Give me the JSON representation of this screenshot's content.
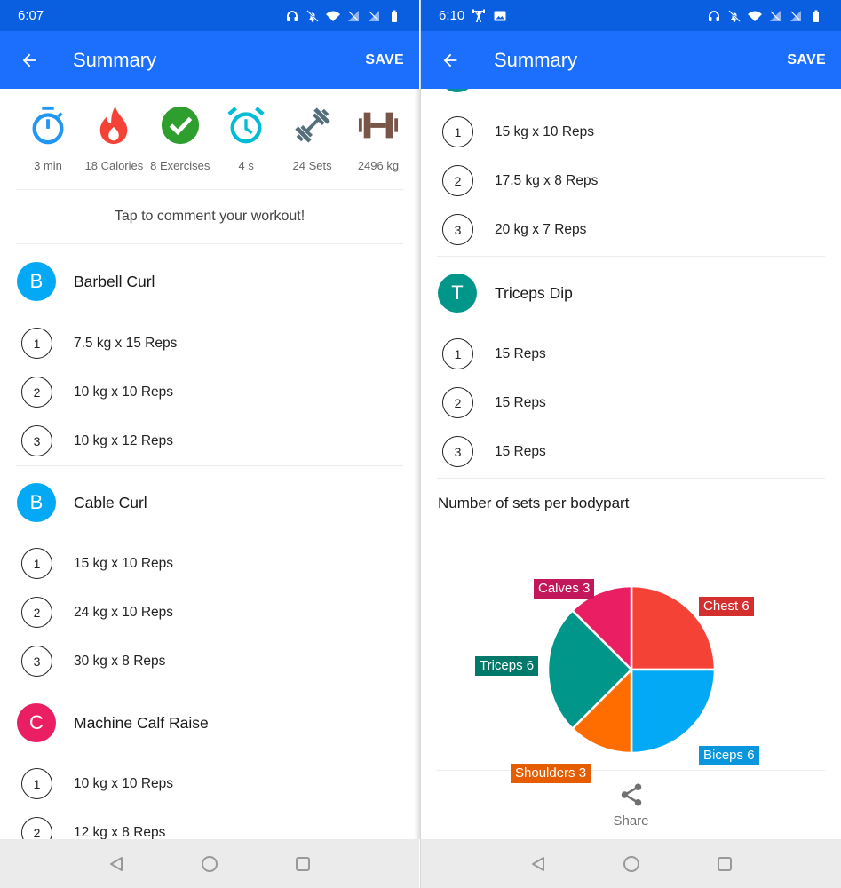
{
  "screens": [
    {
      "status_bar": {
        "time": "6:07",
        "left_icons": [],
        "right_icons": [
          "headset-icon",
          "bell-off-icon",
          "wifi-icon",
          "signal-off-icon",
          "signal-off-icon",
          "battery-icon"
        ]
      },
      "app_bar": {
        "back_icon": "arrow-back-icon",
        "title": "Summary",
        "save_label": "SAVE"
      },
      "stats": [
        {
          "icon": "stopwatch-icon",
          "label": "3 min",
          "color": "#2196f3"
        },
        {
          "icon": "flame-icon",
          "label": "18 Calories",
          "color": "#f44336"
        },
        {
          "icon": "check-circle-icon",
          "label": "8 Exercises",
          "color": "#2e9e2e"
        },
        {
          "icon": "alarm-clock-icon",
          "label": "4 s",
          "color": "#00bcd4"
        },
        {
          "icon": "dumbbell-icon",
          "label": "24 Sets",
          "color": "#546e7a"
        },
        {
          "icon": "weight-plates-icon",
          "label": "2496 kg",
          "color": "#795548"
        }
      ],
      "comment_prompt": "Tap to comment your workout!",
      "exercises": [
        {
          "initial": "B",
          "name": "Barbell Curl",
          "color": "#03a9f4",
          "sets": [
            {
              "num": "1",
              "text": "7.5 kg x 15 Reps"
            },
            {
              "num": "2",
              "text": "10 kg x 10 Reps"
            },
            {
              "num": "3",
              "text": "10 kg x 12 Reps"
            }
          ]
        },
        {
          "initial": "B",
          "name": "Cable Curl",
          "color": "#03a9f4",
          "sets": [
            {
              "num": "1",
              "text": "15 kg x 10 Reps"
            },
            {
              "num": "2",
              "text": "24 kg x 10 Reps"
            },
            {
              "num": "3",
              "text": "30 kg x 8 Reps"
            }
          ]
        },
        {
          "initial": "C",
          "name": "Machine Calf Raise",
          "color": "#e91e63",
          "sets": [
            {
              "num": "1",
              "text": "10 kg x 10 Reps"
            },
            {
              "num": "2",
              "text": "12 kg x 8 Reps"
            }
          ]
        }
      ],
      "nav_bar": [
        "back-nav-icon",
        "home-nav-icon",
        "recents-nav-icon"
      ]
    },
    {
      "status_bar": {
        "time": "6:10",
        "left_icons": [
          "weightlifter-icon",
          "image-icon"
        ],
        "right_icons": [
          "headset-icon",
          "bell-off-icon",
          "wifi-icon",
          "signal-off-icon",
          "signal-off-icon",
          "battery-icon"
        ]
      },
      "app_bar": {
        "back_icon": "arrow-back-icon",
        "title": "Summary",
        "save_label": "SAVE"
      },
      "partial_exercise": {
        "color": "#00968a",
        "sets": [
          {
            "num": "1",
            "text": "15 kg x 10 Reps"
          },
          {
            "num": "2",
            "text": "17.5 kg x 8 Reps"
          },
          {
            "num": "3",
            "text": "20 kg x 7 Reps"
          }
        ]
      },
      "exercises": [
        {
          "initial": "T",
          "name": "Triceps Dip",
          "color": "#00968a",
          "sets": [
            {
              "num": "1",
              "text": "15 Reps"
            },
            {
              "num": "2",
              "text": "15 Reps"
            },
            {
              "num": "3",
              "text": "15 Reps"
            }
          ]
        }
      ],
      "chart_title": "Number of sets per bodypart",
      "share_label": "Share",
      "nav_bar": [
        "back-nav-icon",
        "home-nav-icon",
        "recents-nav-icon"
      ]
    }
  ],
  "chart_data": {
    "type": "pie",
    "title": "Number of sets per bodypart",
    "categories": [
      "Chest",
      "Biceps",
      "Shoulders",
      "Triceps",
      "Calves"
    ],
    "values": [
      6,
      6,
      3,
      6,
      3
    ],
    "labels": [
      "Chest 6",
      "Biceps 6",
      "Shoulders 3",
      "Triceps 6",
      "Calves 3"
    ],
    "colors": [
      "#f44336",
      "#03a9f4",
      "#ff6d00",
      "#00968a",
      "#e91e63"
    ],
    "label_colors": [
      "#d32f2f",
      "#0a96dc",
      "#e65c00",
      "#00796b",
      "#c2185b"
    ],
    "start": "top",
    "direction": "clockwise",
    "legend": "none"
  }
}
